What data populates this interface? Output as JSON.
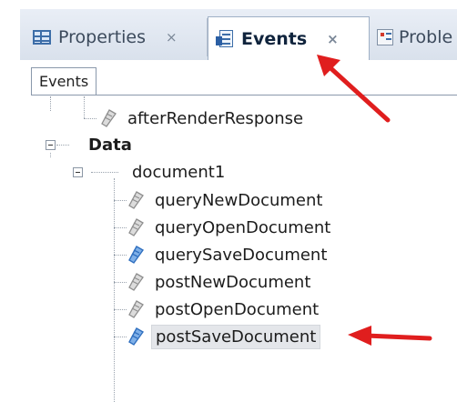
{
  "tabs": [
    {
      "label": "Properties",
      "icon": "properties-grid-icon",
      "close": "×"
    },
    {
      "label": "Events",
      "icon": "events-icon",
      "close": "×",
      "active": true
    },
    {
      "label": "Proble",
      "icon": "problems-icon"
    }
  ],
  "panel": {
    "header": "Events"
  },
  "tree": {
    "after_render": "afterRenderResponse",
    "data_group": "Data",
    "document": "document1",
    "events": [
      {
        "label": "queryNewDocument",
        "has_code": false
      },
      {
        "label": "queryOpenDocument",
        "has_code": false
      },
      {
        "label": "querySaveDocument",
        "has_code": true
      },
      {
        "label": "postNewDocument",
        "has_code": false
      },
      {
        "label": "postOpenDocument",
        "has_code": false
      },
      {
        "label": "postSaveDocument",
        "has_code": true,
        "selected": true
      }
    ]
  },
  "colors": {
    "annotation_arrow": "#e01e1e",
    "event_with_code": "#2f6fbf",
    "event_empty": "#9a9a9a"
  }
}
